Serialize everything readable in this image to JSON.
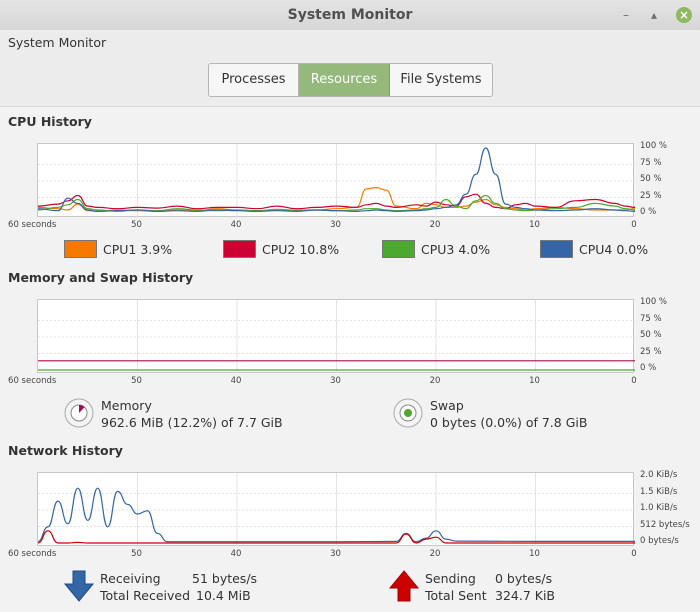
{
  "window": {
    "title": "System Monitor"
  },
  "menubar": {
    "label": "System Monitor"
  },
  "tabs": [
    {
      "label": "Processes",
      "active": false
    },
    {
      "label": "Resources",
      "active": true
    },
    {
      "label": "File Systems",
      "active": false
    }
  ],
  "sections": {
    "cpu": "CPU History",
    "memory": "Memory and Swap History",
    "network": "Network History"
  },
  "axes": {
    "x_ticks": [
      "60 seconds",
      "50",
      "40",
      "30",
      "20",
      "10",
      "0"
    ],
    "percent_ticks": [
      "100 %",
      "75 %",
      "50 %",
      "25 %",
      "0 %"
    ],
    "network_ticks": [
      "2.0 KiB/s",
      "1.5 KiB/s",
      "1.0 KiB/s",
      "512 bytes/s",
      "0 bytes/s"
    ]
  },
  "cpu_legend": [
    {
      "label": "CPU1",
      "value": "3.9%",
      "color": "#f57900"
    },
    {
      "label": "CPU2",
      "value": "10.8%",
      "color": "#cc0033"
    },
    {
      "label": "CPU3",
      "value": "4.0%",
      "color": "#4ca82f"
    },
    {
      "label": "CPU4",
      "value": "0.0%",
      "color": "#3465a4"
    }
  ],
  "memory": {
    "label": "Memory",
    "value": "962.6 MiB (12.2%) of 7.7 GiB",
    "color": "#a50c4a",
    "fraction": 0.122
  },
  "swap": {
    "label": "Swap",
    "value": "0 bytes (0.0%) of 7.8 GiB",
    "color": "#4ca82f",
    "fraction": 0.0
  },
  "network": {
    "receiving_label": "Receiving",
    "receiving_rate": "51 bytes/s",
    "total_received_label": "Total Received",
    "total_received": "10.4 MiB",
    "sending_label": "Sending",
    "sending_rate": "0 bytes/s",
    "total_sent_label": "Total Sent",
    "total_sent": "324.7 KiB",
    "receiving_color": "#3465a4",
    "sending_color": "#cc0000"
  },
  "chart_data": [
    {
      "type": "line",
      "title": "CPU History",
      "x": [
        60,
        58,
        57,
        56,
        55,
        54,
        52,
        50,
        48,
        46,
        44,
        42,
        40,
        38,
        36,
        34,
        32,
        30,
        28,
        27,
        26,
        25,
        24,
        22,
        21,
        20,
        19,
        18,
        17,
        16,
        15,
        14,
        13,
        12,
        11,
        10,
        8,
        6,
        4,
        2,
        1,
        0
      ],
      "ylim": [
        0,
        100
      ],
      "yunit": "%",
      "series": [
        {
          "name": "CPU1",
          "values": [
            10,
            8,
            6,
            15,
            5,
            4,
            6,
            5,
            4,
            6,
            5,
            8,
            6,
            5,
            7,
            6,
            6,
            8,
            10,
            38,
            40,
            36,
            12,
            8,
            16,
            14,
            10,
            10,
            12,
            18,
            22,
            14,
            10,
            8,
            6,
            8,
            10,
            8,
            6,
            6,
            6,
            8
          ]
        },
        {
          "name": "CPU2",
          "values": [
            12,
            15,
            20,
            28,
            12,
            10,
            8,
            10,
            9,
            12,
            8,
            10,
            10,
            8,
            12,
            8,
            10,
            12,
            10,
            14,
            16,
            12,
            10,
            14,
            12,
            18,
            14,
            12,
            26,
            30,
            16,
            10,
            8,
            14,
            16,
            12,
            10,
            20,
            22,
            16,
            12,
            10
          ]
        },
        {
          "name": "CPU3",
          "values": [
            6,
            10,
            14,
            22,
            8,
            6,
            4,
            6,
            5,
            8,
            6,
            5,
            6,
            5,
            6,
            5,
            6,
            5,
            6,
            8,
            8,
            6,
            5,
            6,
            8,
            10,
            22,
            12,
            8,
            20,
            28,
            16,
            8,
            6,
            5,
            6,
            8,
            10,
            16,
            12,
            8,
            6
          ]
        },
        {
          "name": "CPU4",
          "values": [
            8,
            5,
            24,
            16,
            6,
            4,
            5,
            6,
            4,
            5,
            4,
            6,
            5,
            4,
            5,
            4,
            6,
            5,
            4,
            5,
            6,
            5,
            4,
            5,
            6,
            8,
            10,
            14,
            30,
            60,
            100,
            60,
            15,
            10,
            8,
            6,
            5,
            6,
            8,
            6,
            5,
            4
          ]
        }
      ]
    },
    {
      "type": "line",
      "title": "Memory and Swap History",
      "x": [
        60,
        50,
        40,
        30,
        20,
        10,
        0
      ],
      "ylim": [
        0,
        100
      ],
      "yunit": "%",
      "series": [
        {
          "name": "Memory",
          "values": [
            14,
            14,
            14,
            14,
            14,
            14,
            14
          ]
        },
        {
          "name": "Swap",
          "values": [
            0,
            0,
            0,
            0,
            0,
            0,
            0
          ]
        }
      ]
    },
    {
      "type": "line",
      "title": "Network History",
      "x": [
        60,
        59,
        58,
        57,
        56,
        55,
        54,
        53,
        52,
        51,
        50,
        49,
        48,
        47,
        40,
        30,
        24,
        23,
        22,
        21,
        20,
        19,
        18,
        10,
        0
      ],
      "ylim": [
        0,
        2048
      ],
      "yunit": "bytes/s",
      "series": [
        {
          "name": "Receiving",
          "values": [
            50,
            500,
            1300,
            600,
            1700,
            700,
            1700,
            500,
            1600,
            1200,
            900,
            1000,
            300,
            40,
            40,
            40,
            50,
            300,
            40,
            150,
            380,
            120,
            60,
            50,
            51
          ]
        },
        {
          "name": "Sending",
          "values": [
            0,
            380,
            0,
            0,
            20,
            0,
            0,
            0,
            0,
            0,
            0,
            0,
            0,
            0,
            0,
            0,
            0,
            280,
            0,
            120,
            180,
            0,
            0,
            0,
            0
          ]
        }
      ]
    }
  ]
}
